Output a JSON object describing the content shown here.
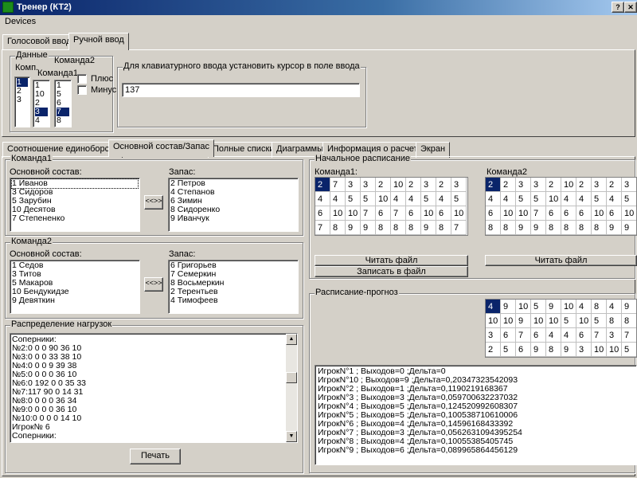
{
  "window": {
    "title": "Тренер (КТ2)",
    "caption_button": "?"
  },
  "menu": {
    "devices": "Devices"
  },
  "top_tabs": [
    "Голосовой ввод",
    "Ручной ввод"
  ],
  "input_panel": {
    "group_label": "Данные",
    "comp_label": "Комп.",
    "team1_label": "Команда1",
    "team2_label": "Команда2",
    "comp_list": [
      "1",
      "2",
      "3"
    ],
    "team1_list": [
      "1",
      "10",
      "2",
      "3",
      "4"
    ],
    "team2_list": [
      "1",
      "5",
      "6",
      "7",
      "8"
    ],
    "plus_label": "Плюс",
    "minus_label": "Минус",
    "keyboard_group_label": "Для клавиатурного ввода установить курсор в поле ввода",
    "input_value": "137"
  },
  "main_tabs": [
    "Соотношение единоборств",
    "Основной состав/Запас",
    "Полные списки",
    "Диаграммы",
    "Информация о расчете",
    "Экран"
  ],
  "team1": {
    "group_label": "Команда1",
    "main_label": "Основной состав:",
    "reserve_label": "Запас:",
    "main": [
      "1 Иванов",
      "3 Сидоров",
      "5 Зарубин",
      "10 Десятов",
      "7 Степененко"
    ],
    "reserve": [
      "2 Петров",
      "4 Степанов",
      "6 Зимин",
      "8 Сидоренко",
      "9 Иванчук"
    ],
    "swap_label": "<<>>"
  },
  "team2": {
    "group_label": "Команда2",
    "main_label": "Основной состав:",
    "reserve_label": "Запас:",
    "main": [
      "1 Седов",
      "3 Титов",
      "5 Макаров",
      "10 Бендукидзе",
      "9 Девяткин"
    ],
    "reserve": [
      "6 Григорьев",
      "7 Семеркин",
      "8 Восьмеркин",
      "2 Терентьев",
      "4 Тимофеев"
    ],
    "swap_label": "<<>>"
  },
  "load_distribution": {
    "group_label": "Распределение нагрузок",
    "lines": [
      "Соперники:",
      "№2:0 0 0 90 36 10",
      "№3:0 0 0 33 38 10",
      "№4:0 0 0 9 39 38",
      "№5:0 0 0 0 36 10",
      "№6:0 192 0 0 35 33",
      "№7:117 90 0 14 31",
      "№8:0 0 0 0 36 34",
      "№9:0 0 0 0 36 10",
      "№10:0 0 0 0 14 10",
      "Игрок№ 6",
      "Соперники:"
    ],
    "print_button": "Печать"
  },
  "initial_schedule": {
    "group_label": "Начальное расписание",
    "team1_label": "Команда1:",
    "team2_label": "Команда2",
    "team1_grid": [
      [
        "2",
        "7",
        "3",
        "3",
        "2",
        "10",
        "2",
        "3",
        "2",
        "3"
      ],
      [
        "4",
        "4",
        "5",
        "5",
        "10",
        "4",
        "4",
        "5",
        "4",
        "5"
      ],
      [
        "6",
        "10",
        "10",
        "7",
        "6",
        "7",
        "6",
        "10",
        "6",
        "10"
      ],
      [
        "7",
        "8",
        "9",
        "9",
        "8",
        "8",
        "8",
        "9",
        "8",
        "7"
      ]
    ],
    "team2_grid": [
      [
        "2",
        "2",
        "3",
        "3",
        "2",
        "10",
        "2",
        "3",
        "2",
        "3"
      ],
      [
        "4",
        "4",
        "5",
        "5",
        "10",
        "4",
        "4",
        "5",
        "4",
        "5"
      ],
      [
        "6",
        "10",
        "10",
        "7",
        "6",
        "6",
        "6",
        "10",
        "6",
        "10"
      ],
      [
        "8",
        "8",
        "9",
        "9",
        "8",
        "8",
        "8",
        "8",
        "9",
        "9"
      ]
    ],
    "read_file_1": "Читать файл",
    "write_file": "Записать в файл",
    "read_file_2": "Читать файл"
  },
  "forecast": {
    "group_label": "Расписание-прогноз",
    "grid": [
      [
        "4",
        "9",
        "10",
        "5",
        "9",
        "10",
        "4",
        "8",
        "4",
        "9"
      ],
      [
        "10",
        "10",
        "9",
        "10",
        "10",
        "5",
        "10",
        "5",
        "8",
        "8"
      ],
      [
        "3",
        "6",
        "7",
        "6",
        "4",
        "4",
        "6",
        "7",
        "3",
        "7"
      ],
      [
        "2",
        "5",
        "6",
        "9",
        "8",
        "9",
        "3",
        "10",
        "10",
        "5"
      ]
    ],
    "log": [
      "ИгрокN°1 ; Выходов=0 ;Дельта=0",
      "ИгрокN°10 ; Выходов=9 ;Дельта=0,20347323542093",
      "ИгрокN°2 ; Выходов=1 ;Дельта=0,1190219168367",
      "ИгрокN°3 ; Выходов=3 ;Дельта=0,059700632237032",
      "ИгрокN°4 ; Выходов=5 ;Дельта=0,124520992608307",
      "ИгрокN°5 ; Выходов=5 ;Дельта=0,100538710610006",
      "ИгрокN°6 ; Выходов=4 ;Дельта=0,14596168433392",
      "ИгрокN°7 ; Выходов=3 ;Дельта=0,0562631094395254",
      "ИгрокN°8 ; Выходов=4 ;Дельта=0,10055385405745",
      "ИгрокN°9 ; Выходов=6 ;Дельта=0,089965864456129"
    ]
  },
  "colors": {
    "face": "#d4d0c8",
    "title_start": "#0a246a",
    "title_end": "#a6caf0",
    "selection": "#0a246a"
  }
}
